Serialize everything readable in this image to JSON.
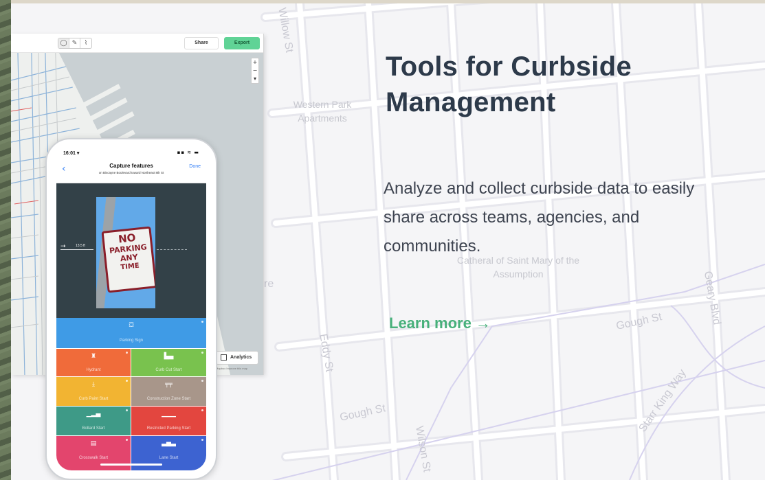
{
  "hero": {
    "headline": "Tools for Curbside Management",
    "description": "Analyze and collect curbside data to easily share across teams, agencies, and communities.",
    "cta_label": "Learn more →",
    "colors": {
      "headline": "#2d3a4a",
      "cta": "#47b07a",
      "export": "#60d396"
    }
  },
  "map": {
    "labels": [
      "Western Park Apartments",
      "Catheral of Saint Mary of the Assumption",
      "Gough St",
      "Gough St",
      "Geary Blvd",
      "Starr King Way",
      "Eddy St",
      "Wilson St",
      "Willow St",
      "re"
    ]
  },
  "desktop_app": {
    "share_label": "Share",
    "export_label": "Export",
    "analytics_label": "Analytics",
    "zoom": [
      "+",
      "−",
      "▾"
    ],
    "attribution": "Mapbox Improve this map",
    "tools": [
      "select-icon",
      "pan-icon",
      "draw-icon"
    ]
  },
  "phone": {
    "status_time": "16:01 ▾",
    "status_icons": "▪▪ ≋ ▬",
    "title": "Capture features",
    "subtitle": "on Biscayne Boulevard toward Northeast 8th St",
    "done_label": "Done",
    "back_icon": "chevron-left-icon",
    "photo_sign": [
      "NO",
      "PARKING",
      "ANY",
      "TIME"
    ],
    "measure_label": "13.5 ft",
    "features": [
      {
        "label": "Parking Sign",
        "color": "#3f9be6"
      },
      {
        "label": "Hydrant",
        "color": "#f06b3a"
      },
      {
        "label": "Curb Cut Start",
        "color": "#79c24e"
      },
      {
        "label": "Curb Paint Start",
        "color": "#f2b432"
      },
      {
        "label": "Construction Zone Start",
        "color": "#a8968a"
      },
      {
        "label": "Bollard Start",
        "color": "#3e9a87"
      },
      {
        "label": "Restricted Parking Start",
        "color": "#e3463f"
      },
      {
        "label": "Crosswalk Start",
        "color": "#e3456d"
      },
      {
        "label": "Lane Start",
        "color": "#3d63d1"
      }
    ]
  }
}
